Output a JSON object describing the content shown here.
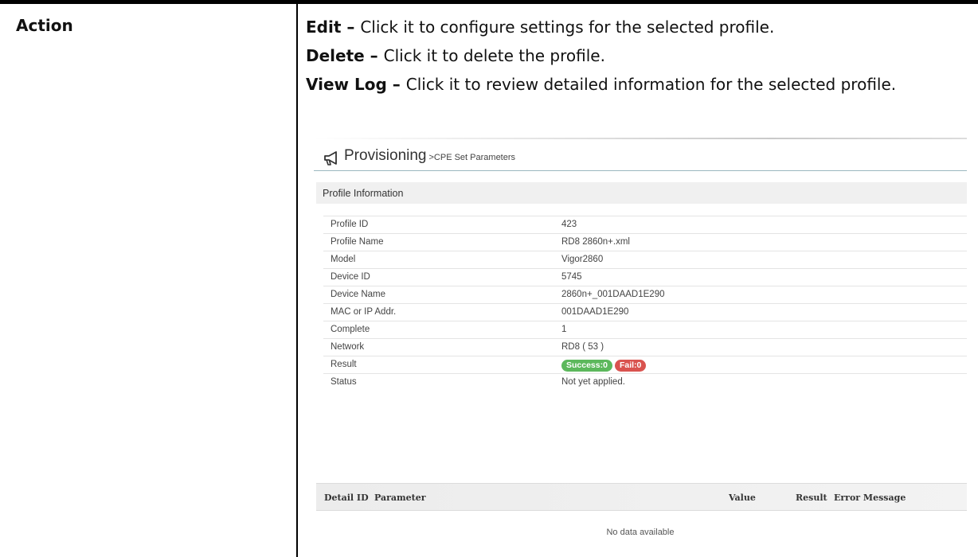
{
  "field_label": "Action",
  "descriptions": [
    {
      "term": "Edit",
      "sep": " – ",
      "text": "Click it to configure settings for the selected profile."
    },
    {
      "term": "Delete",
      "sep": " – ",
      "text": "Click it to delete the profile."
    },
    {
      "term": "View Log",
      "sep": " – ",
      "text": "Click it to review detailed information for the selected profile."
    }
  ],
  "screenshot": {
    "icon": "megaphone-icon",
    "title": "Provisioning",
    "breadcrumb": ">CPE Set Parameters",
    "section_title": "Profile Information",
    "rows": [
      {
        "label": "Profile ID",
        "value": "423"
      },
      {
        "label": "Profile Name",
        "value": "RD8 2860n+.xml"
      },
      {
        "label": "Model",
        "value": "Vigor2860"
      },
      {
        "label": "Device ID",
        "value": "5745"
      },
      {
        "label": "Device Name",
        "value": "2860n+_001DAAD1E290"
      },
      {
        "label": "MAC or IP Addr.",
        "value": "001DAAD1E290"
      },
      {
        "label": "Complete",
        "value": "1"
      },
      {
        "label": "Network",
        "value": "RD8 ( 53 )"
      },
      {
        "label": "Result",
        "badges": [
          {
            "text": "Success:0",
            "color": "#5cb85c"
          },
          {
            "text": "Fail:0",
            "color": "#d9534f"
          }
        ]
      },
      {
        "label": "Status",
        "value": "Not yet applied."
      }
    ],
    "detail_columns": [
      "Detail ID",
      "Parameter",
      "Value",
      "Result",
      "Error Message"
    ],
    "empty_text": "No data available"
  }
}
